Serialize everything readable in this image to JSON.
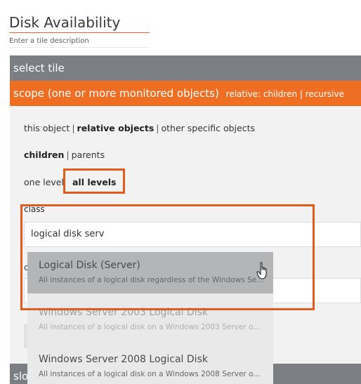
{
  "tile": {
    "title": "Disk Availability",
    "description_placeholder": "Enter a tile description"
  },
  "sections": {
    "select_tile": "select tile",
    "scope_title": "scope (one or more monitored objects)",
    "scope_summary": "relative: children | recursive",
    "bottom_bar": "slo"
  },
  "scope_options": {
    "target": {
      "this_object": "this object",
      "relative_objects": "relative objects",
      "other_specific": "other specific objects",
      "separator": "|"
    },
    "relation": {
      "children": "children",
      "parents": "parents",
      "separator": "|"
    },
    "depth": {
      "one_level": "one level",
      "all_levels": "all levels"
    }
  },
  "class_field": {
    "label": "class",
    "value": "logical disk serv"
  },
  "hidden_row": {
    "label": "c"
  },
  "dropdown": {
    "items": [
      {
        "name": "Logical Disk (Server)",
        "description": "All instances of a logical disk regardless of the Windows Se..."
      },
      {
        "name": "Windows Server 2003 Logical Disk",
        "description": "All instances of a logical disk on a Windows 2003 Server o..."
      },
      {
        "name": "Windows Server 2008 Logical Disk",
        "description": "All instances of a logical disk on a Windows 2008 Server o..."
      }
    ]
  },
  "colors": {
    "accent_orange": "#ee6f24",
    "highlight_border": "#e15a1e",
    "section_gray": "#7b7f84",
    "selected_item": "#b3b5b7"
  },
  "icons": {
    "pointer": "hand-pointer-icon"
  }
}
